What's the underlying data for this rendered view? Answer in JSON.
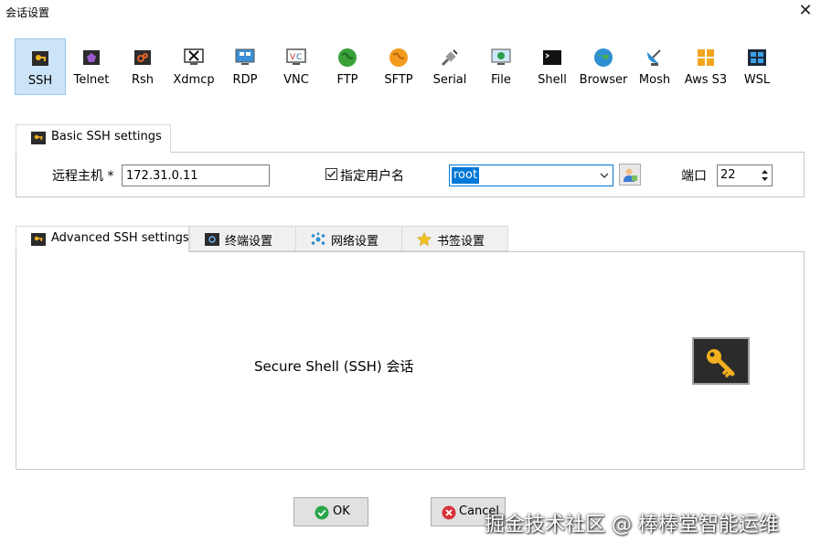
{
  "window": {
    "title": "会话设置",
    "close_glyph": "✕"
  },
  "toolbar": {
    "items": [
      {
        "label": "SSH",
        "icon": "ssh-key-icon",
        "selected": true
      },
      {
        "label": "Telnet",
        "icon": "telnet-icon"
      },
      {
        "label": "Rsh",
        "icon": "rsh-icon"
      },
      {
        "label": "Xdmcp",
        "icon": "xdmcp-icon"
      },
      {
        "label": "RDP",
        "icon": "rdp-monitor-icon"
      },
      {
        "label": "VNC",
        "icon": "vnc-monitor-icon"
      },
      {
        "label": "FTP",
        "icon": "ftp-globe-icon"
      },
      {
        "label": "SFTP",
        "icon": "sftp-globe-icon"
      },
      {
        "label": "Serial",
        "icon": "serial-plug-icon"
      },
      {
        "label": "File",
        "icon": "file-monitor-icon"
      },
      {
        "label": "Shell",
        "icon": "terminal-icon"
      },
      {
        "label": "Browser",
        "icon": "browser-globe-icon"
      },
      {
        "label": "Mosh",
        "icon": "satellite-dish-icon"
      },
      {
        "label": "Aws S3",
        "icon": "aws-s3-cubes-icon"
      },
      {
        "label": "WSL",
        "icon": "windows-logo-icon"
      }
    ]
  },
  "basic": {
    "tab_label": "Basic SSH settings",
    "remote_host_label": "远程主机 *",
    "remote_host_value": "172.31.0.11",
    "specify_user_label": "指定用户名",
    "specify_user_checked": true,
    "username_value": "root",
    "port_label": "端口",
    "port_value": "22"
  },
  "advanced": {
    "tabs": [
      {
        "label": "Advanced SSH settings",
        "icon": "key-icon"
      },
      {
        "label": "终端设置",
        "icon": "terminal-settings-icon"
      },
      {
        "label": "网络设置",
        "icon": "network-icon"
      },
      {
        "label": "书签设置",
        "icon": "star-icon"
      }
    ],
    "description": "Secure Shell (SSH) 会话"
  },
  "buttons": {
    "ok": "OK",
    "cancel": "Cancel"
  },
  "watermark": "掘金技术社区 @ 棒棒堂智能运维",
  "colors": {
    "selection_blue": "#0078d7",
    "selected_tool_bg": "#cce4f7",
    "ok_green": "#2aa64a",
    "cancel_red": "#d9333a",
    "key_gold": "#f2b01e"
  }
}
